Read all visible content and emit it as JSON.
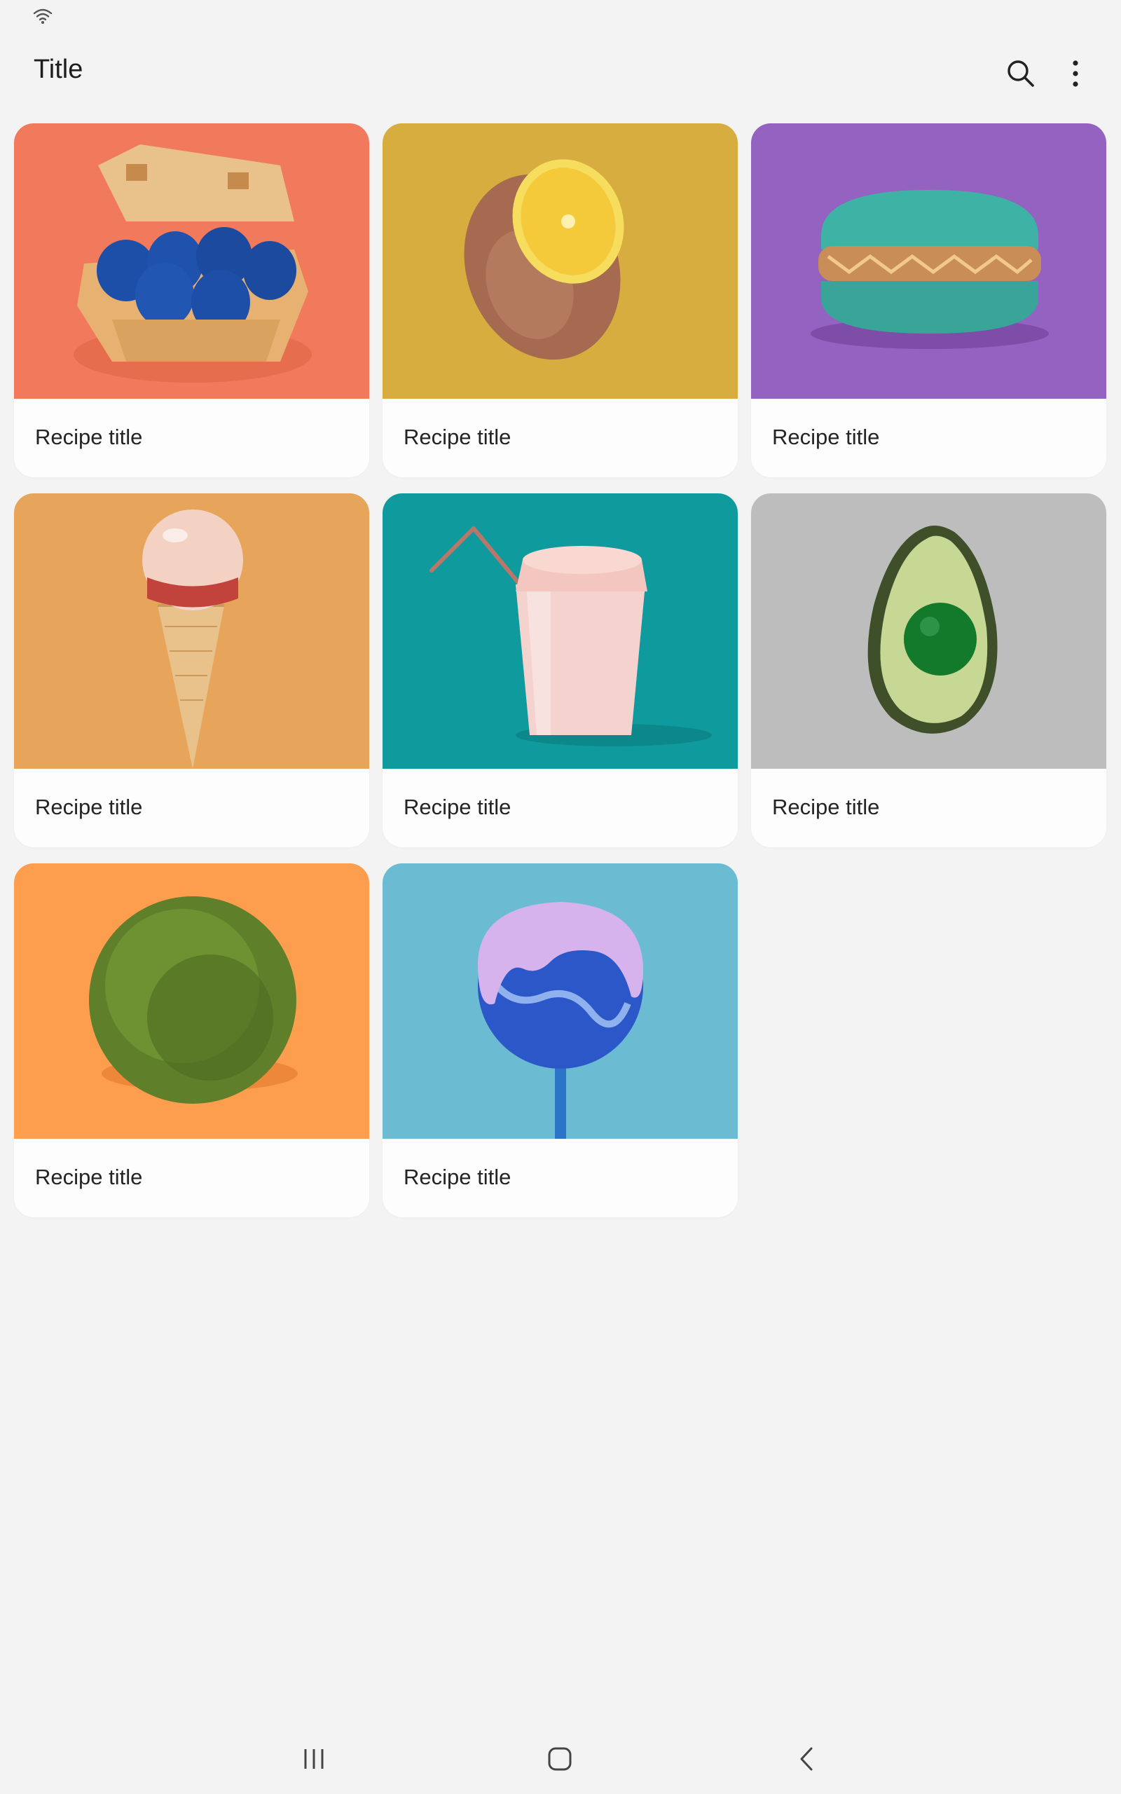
{
  "status_bar": {
    "wifi_icon": "wifi-icon"
  },
  "app_bar": {
    "title": "Title",
    "actions": [
      "search-icon",
      "more-vert-icon"
    ]
  },
  "recipes": [
    {
      "label": "Recipe title",
      "image": "blue eggs in carton",
      "bg": "#f27a5c"
    },
    {
      "label": "Recipe title",
      "image": "copper lemon",
      "bg": "#d6ad3e"
    },
    {
      "label": "Recipe title",
      "image": "teal macaron",
      "bg": "#9462c0"
    },
    {
      "label": "Recipe title",
      "image": "ice cream cone with glass bubble",
      "bg": "#e6a55a"
    },
    {
      "label": "Recipe title",
      "image": "pink cup with straw",
      "bg": "#0f9b9e"
    },
    {
      "label": "Recipe title",
      "image": "avocado with green ball",
      "bg": "#bdbdbd"
    },
    {
      "label": "Recipe title",
      "image": "green moss ball",
      "bg": "#fd9e4e"
    },
    {
      "label": "Recipe title",
      "image": "blue lollipop with purple drip",
      "bg": "#6bbcd3"
    }
  ],
  "nav_bar": {
    "items": [
      "recent-apps-icon",
      "home-icon",
      "back-icon"
    ]
  }
}
